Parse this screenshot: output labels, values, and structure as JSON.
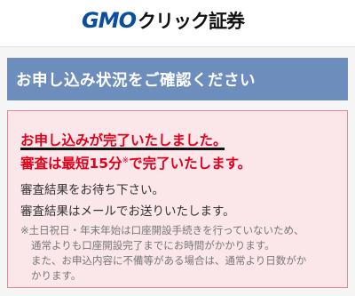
{
  "header": {
    "logo_gmo": "GMO",
    "logo_rest": "クリック証券"
  },
  "title_bar": {
    "title": "お申し込み状況をご確認ください"
  },
  "status": {
    "complete": "お申し込みが完了いたしました。",
    "review_prefix": "審査は最短15分",
    "review_mark": "※",
    "review_suffix": "で完了いたします。",
    "line1": "審査結果をお待ち下さい。",
    "line2": "審査結果はメールでお送りいたします。",
    "note1": "※土日祝日・年末年始は口座開設手続きを行っていないため、",
    "note2": "通常よりも口座開設完了までにお時間がかかります。",
    "note3": "また、お申込内容に不備等がある場合は、通常より日数がか",
    "note4": "かります。"
  },
  "colors": {
    "brand_blue": "#0a4ea2",
    "title_bar": "#6d8dbd",
    "panel_bg": "#fbe6ea",
    "panel_border": "#e58a95",
    "alert_red": "#e3001b"
  }
}
